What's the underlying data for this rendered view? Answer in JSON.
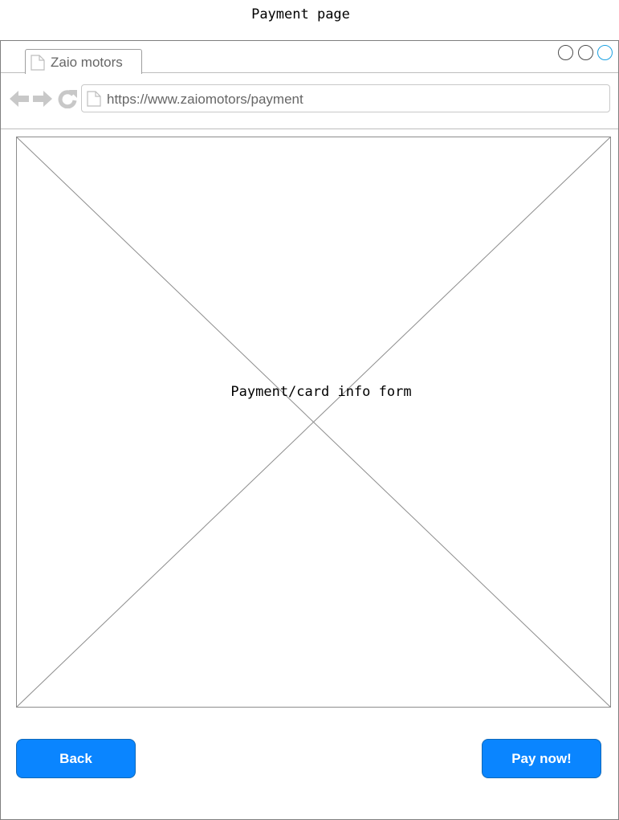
{
  "page": {
    "title": "Payment page"
  },
  "browser": {
    "tab": {
      "label": "Zaio motors",
      "icon": "document-icon"
    },
    "url": "https://www.zaiomotors/payment",
    "nav_icons": [
      "back-arrow-icon",
      "forward-arrow-icon",
      "refresh-icon"
    ],
    "window_buttons": [
      "minimize",
      "maximize",
      "close"
    ]
  },
  "main": {
    "placeholder_label": "Payment/card info form"
  },
  "actions": {
    "back_label": "Back",
    "pay_label": "Pay now!"
  },
  "colors": {
    "button_fill": "#0a85ff",
    "button_border": "#1068b8",
    "close_button_accent": "#1ba1e2",
    "nav_icon": "#c8c8c8"
  }
}
